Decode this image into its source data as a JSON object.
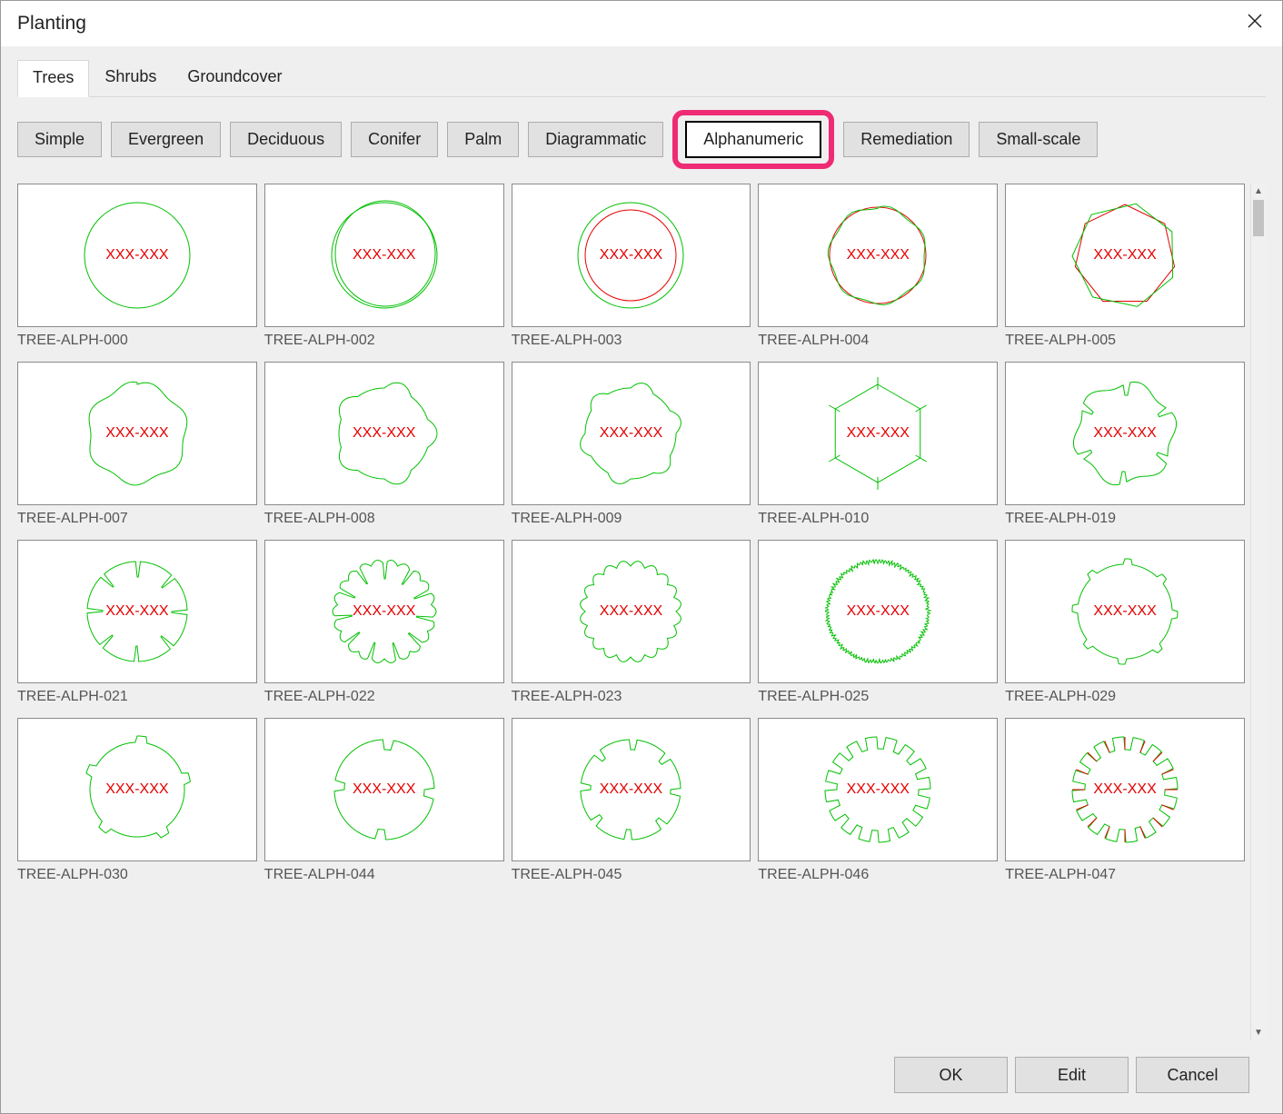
{
  "window": {
    "title": "Planting"
  },
  "tabs_primary": [
    {
      "label": "Trees",
      "active": true
    },
    {
      "label": "Shrubs",
      "active": false
    },
    {
      "label": "Groundcover",
      "active": false
    }
  ],
  "tabs_category": [
    {
      "label": "Simple",
      "active": false
    },
    {
      "label": "Evergreen",
      "active": false
    },
    {
      "label": "Deciduous",
      "active": false
    },
    {
      "label": "Conifer",
      "active": false
    },
    {
      "label": "Palm",
      "active": false
    },
    {
      "label": "Diagrammatic",
      "active": false
    },
    {
      "label": "Alphanumeric",
      "active": true,
      "highlighted": true
    },
    {
      "label": "Remediation",
      "active": false
    },
    {
      "label": "Small-scale",
      "active": false
    }
  ],
  "tiles": [
    {
      "label": "TREE-ALPH-000",
      "placeholder": "XXX-XXX",
      "shape": "circle"
    },
    {
      "label": "TREE-ALPH-002",
      "placeholder": "XXX-XXX",
      "shape": "dblcircle"
    },
    {
      "label": "TREE-ALPH-003",
      "placeholder": "XXX-XXX",
      "shape": "circle_red_inner"
    },
    {
      "label": "TREE-ALPH-004",
      "placeholder": "XXX-XXX",
      "shape": "red_green_circle"
    },
    {
      "label": "TREE-ALPH-005",
      "placeholder": "XXX-XXX",
      "shape": "heptagon_red_green"
    },
    {
      "label": "TREE-ALPH-007",
      "placeholder": "XXX-XXX",
      "shape": "wavy"
    },
    {
      "label": "TREE-ALPH-008",
      "placeholder": "XXX-XXX",
      "shape": "cloud5"
    },
    {
      "label": "TREE-ALPH-009",
      "placeholder": "XXX-XXX",
      "shape": "cloud6"
    },
    {
      "label": "TREE-ALPH-010",
      "placeholder": "XXX-XXX",
      "shape": "hexagon_ticks"
    },
    {
      "label": "TREE-ALPH-019",
      "placeholder": "XXX-XXX",
      "shape": "cloud6_cuts"
    },
    {
      "label": "TREE-ALPH-021",
      "placeholder": "XXX-XXX",
      "shape": "circle_vcut"
    },
    {
      "label": "TREE-ALPH-022",
      "placeholder": "XXX-XXX",
      "shape": "scallop_cuts"
    },
    {
      "label": "TREE-ALPH-023",
      "placeholder": "XXX-XXX",
      "shape": "scallop_dense"
    },
    {
      "label": "TREE-ALPH-025",
      "placeholder": "XXX-XXX",
      "shape": "hairy"
    },
    {
      "label": "TREE-ALPH-029",
      "placeholder": "XXX-XXX",
      "shape": "octagon_bumps"
    },
    {
      "label": "TREE-ALPH-030",
      "placeholder": "XXX-XXX",
      "shape": "pentagon_bumps"
    },
    {
      "label": "TREE-ALPH-044",
      "placeholder": "XXX-XXX",
      "shape": "circle_4notch"
    },
    {
      "label": "TREE-ALPH-045",
      "placeholder": "XXX-XXX",
      "shape": "circle_8notch"
    },
    {
      "label": "TREE-ALPH-046",
      "placeholder": "XXX-XXX",
      "shape": "gear_small"
    },
    {
      "label": "TREE-ALPH-047",
      "placeholder": "XXX-XXX",
      "shape": "gear_red_green"
    }
  ],
  "footer": {
    "ok": "OK",
    "edit": "Edit",
    "cancel": "Cancel"
  }
}
